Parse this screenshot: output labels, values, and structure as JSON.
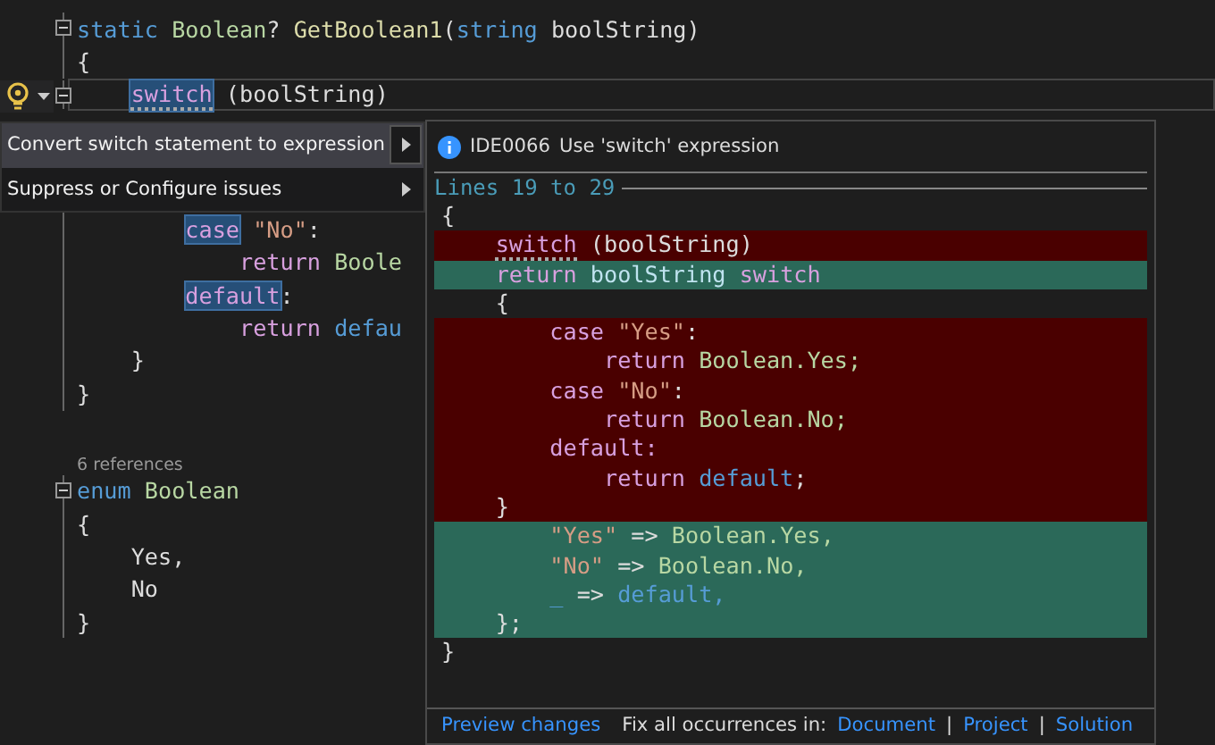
{
  "editor": {
    "lines": [
      {
        "collapsible": true,
        "tokens": [
          {
            "text": "static",
            "kind": "kw"
          },
          {
            "text": " Boolean",
            "kind": "type"
          },
          {
            "text": "?",
            "kind": "plain"
          },
          {
            "text": " GetBoolean1",
            "kind": "fn"
          },
          {
            "text": "(",
            "kind": "plain"
          },
          {
            "text": "string",
            "kind": "kw"
          },
          {
            "text": " boolString)",
            "kind": "plain"
          }
        ]
      },
      {
        "tokens": [
          {
            "text": "{",
            "kind": "plain"
          }
        ],
        "children": [
          {
            "collapsible": true,
            "current": true,
            "tokens": [
              {
                "text": "switch",
                "kind": "ctl",
                "marked": true,
                "hint": true
              },
              {
                "text": " (boolString)",
                "kind": "plain"
              }
            ],
            "children": [
              {
                "tokens": [
                  {
                    "text": "case",
                    "kind": "ctl",
                    "marked": true
                  },
                  {
                    "text": " \"No\"",
                    "kind": "str"
                  },
                  {
                    "text": ":",
                    "kind": "plain"
                  }
                ],
                "children": [
                  {
                    "tokens": [
                      {
                        "text": "return",
                        "kind": "ctl"
                      },
                      {
                        "text": " Boole",
                        "kind": "type"
                      }
                    ]
                  }
                ]
              },
              {
                "tokens": [
                  {
                    "text": "default",
                    "kind": "ctl",
                    "marked": true
                  },
                  {
                    "text": ":",
                    "kind": "plain"
                  }
                ],
                "children": [
                  {
                    "tokens": [
                      {
                        "text": "return",
                        "kind": "ctl"
                      },
                      {
                        "text": " defau",
                        "kind": "kw"
                      }
                    ]
                  }
                ]
              }
            ]
          },
          {
            "tokens": [
              {
                "text": "}",
                "kind": "plain"
              }
            ]
          }
        ]
      },
      {
        "tokens": [
          {
            "text": "}",
            "kind": "plain"
          }
        ]
      },
      {
        "lens": "6 references"
      },
      {
        "collapsible": true,
        "tokens": [
          {
            "text": "enum",
            "kind": "kw"
          },
          {
            "text": " Boolean",
            "kind": "type"
          }
        ]
      },
      {
        "tokens": [
          {
            "text": "{",
            "kind": "plain"
          }
        ],
        "children": [
          {
            "tokens": [
              {
                "text": "Yes,",
                "kind": "plain"
              }
            ]
          },
          {
            "tokens": [
              {
                "text": "No",
                "kind": "plain"
              }
            ]
          }
        ]
      },
      {
        "tokens": [
          {
            "text": "}",
            "kind": "plain"
          }
        ]
      }
    ]
  },
  "quick_actions_menu": [
    {
      "label": "Convert switch statement to expression",
      "selected": true
    },
    {
      "label": "Suppress or Configure issues",
      "selected": false
    }
  ],
  "preview": {
    "diagnostic_id": "IDE0066",
    "message": "Use 'switch' expression",
    "range": "Lines 19 to 29",
    "lines": [
      {
        "kind": "plain",
        "tokens": [
          {
            "text": "{",
            "kind": "plain"
          }
        ],
        "children": [
          {
            "kind": "removed",
            "tokens": [
              {
                "text": "switch",
                "kind": "ctl",
                "hint": true
              },
              {
                "text": " (boolString)",
                "kind": "plain"
              }
            ]
          },
          {
            "kind": "added",
            "tokens": [
              {
                "text": "return",
                "kind": "ctl"
              },
              {
                "text": " boolString",
                "kind": "param"
              },
              {
                "text": " switch",
                "kind": "ctl"
              }
            ]
          },
          {
            "kind": "plain",
            "tokens": [
              {
                "text": "{",
                "kind": "plain"
              }
            ],
            "children": [
              {
                "kind": "removed",
                "tokens": [
                  {
                    "text": "case",
                    "kind": "ctl"
                  },
                  {
                    "text": " \"Yes\"",
                    "kind": "str"
                  },
                  {
                    "text": ":",
                    "kind": "plain"
                  }
                ],
                "children": [
                  {
                    "kind": "removed",
                    "tokens": [
                      {
                        "text": "return",
                        "kind": "ctl"
                      },
                      {
                        "text": " Boolean.Yes;",
                        "kind": "type"
                      }
                    ]
                  }
                ]
              },
              {
                "kind": "removed",
                "tokens": [
                  {
                    "text": "case",
                    "kind": "ctl"
                  },
                  {
                    "text": " \"No\"",
                    "kind": "str"
                  },
                  {
                    "text": ":",
                    "kind": "plain"
                  }
                ],
                "children": [
                  {
                    "kind": "removed",
                    "tokens": [
                      {
                        "text": "return",
                        "kind": "ctl"
                      },
                      {
                        "text": " Boolean.No;",
                        "kind": "type"
                      }
                    ]
                  }
                ]
              },
              {
                "kind": "removed",
                "tokens": [
                  {
                    "text": "default:",
                    "kind": "ctl"
                  }
                ],
                "children": [
                  {
                    "kind": "removed",
                    "tokens": [
                      {
                        "text": "return",
                        "kind": "ctl"
                      },
                      {
                        "text": " default",
                        "kind": "kw"
                      },
                      {
                        "text": ";",
                        "kind": "plain"
                      }
                    ]
                  }
                ]
              }
            ]
          },
          {
            "kind": "removed",
            "tokens": [
              {
                "text": "}",
                "kind": "plain"
              }
            ],
            "children": [
              {
                "kind": "added",
                "tokens": [
                  {
                    "text": "\"Yes\"",
                    "kind": "str"
                  },
                  {
                    "text": " =>",
                    "kind": "plain"
                  },
                  {
                    "text": " Boolean.Yes,",
                    "kind": "type"
                  }
                ]
              },
              {
                "kind": "added",
                "tokens": [
                  {
                    "text": "\"No\"",
                    "kind": "str"
                  },
                  {
                    "text": " =>",
                    "kind": "plain"
                  },
                  {
                    "text": " Boolean.No,",
                    "kind": "type"
                  }
                ]
              },
              {
                "kind": "added",
                "tokens": [
                  {
                    "text": "_",
                    "kind": "kw"
                  },
                  {
                    "text": " =>",
                    "kind": "plain"
                  },
                  {
                    "text": " default,",
                    "kind": "kw"
                  }
                ]
              }
            ]
          },
          {
            "kind": "added",
            "tokens": [
              {
                "text": "};",
                "kind": "plain"
              }
            ]
          }
        ]
      },
      {
        "kind": "plain",
        "tokens": [
          {
            "text": "}",
            "kind": "plain"
          }
        ]
      }
    ],
    "footer": [
      {
        "text": "Preview changes",
        "kind": "link"
      },
      {
        "text": "Fix all occurrences in:",
        "kind": "label"
      },
      {
        "text": "Document",
        "kind": "link"
      },
      {
        "text": "|",
        "kind": "sep"
      },
      {
        "text": "Project",
        "kind": "link"
      },
      {
        "text": "|",
        "kind": "sep"
      },
      {
        "text": "Solution",
        "kind": "link"
      }
    ]
  }
}
